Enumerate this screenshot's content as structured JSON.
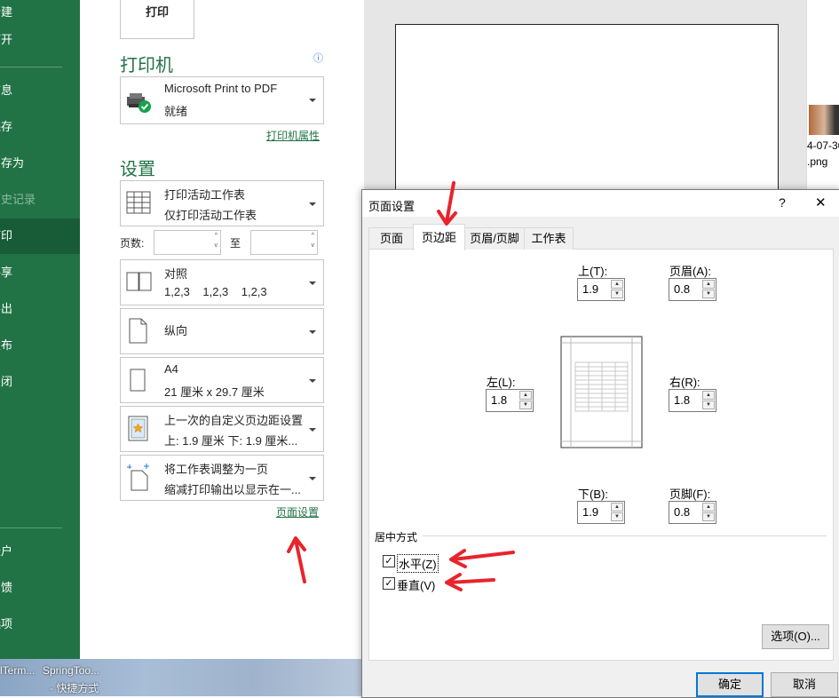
{
  "nav": {
    "items": [
      "新建",
      "打开",
      "信息",
      "保存",
      "另存为",
      "历史记录",
      "打印",
      "共享",
      "导出",
      "发布",
      "关闭",
      "帐户",
      "反馈",
      "选项"
    ],
    "active": "打印",
    "disabled": "历史记录"
  },
  "desktop": {
    "icon1_label": "lTerm...",
    "icon2_label": "SpringToo...",
    "icon2_sub": "- 快捷方式"
  },
  "print_button": "打印",
  "printer": {
    "section_title": "打印机",
    "name": "Microsoft Print to PDF",
    "status": "就绪",
    "properties_link": "打印机属性",
    "info_icon": "ⓘ"
  },
  "settings": {
    "section_title": "设置",
    "scope": {
      "title": "打印活动工作表",
      "desc": "仅打印活动工作表"
    },
    "pages_label": "页数:",
    "to_label": "至",
    "collate": {
      "title": "对照",
      "desc": "1,2,3    1,2,3    1,2,3"
    },
    "orientation": {
      "title": "纵向"
    },
    "paper": {
      "title": "A4",
      "desc": "21 厘米 x 29.7 厘米"
    },
    "margins": {
      "title": "上一次的自定义页边距设置",
      "desc": "上: 1.9 厘米 下: 1.9 厘米..."
    },
    "scaling": {
      "title": "将工作表调整为一页",
      "desc": "缩减打印输出以显示在一..."
    },
    "page_setup_link": "页面设置"
  },
  "thumb": {
    "label1": "4-07-30",
    "label2": ".png"
  },
  "dialog": {
    "title": "页面设置",
    "help": "?",
    "close": "✕",
    "tabs": [
      "页面",
      "页边距",
      "页眉/页脚",
      "工作表"
    ],
    "active_tab": "页边距",
    "top": {
      "label": "上(T):",
      "value": "1.9"
    },
    "header": {
      "label": "页眉(A):",
      "value": "0.8"
    },
    "left": {
      "label": "左(L):",
      "value": "1.8"
    },
    "right": {
      "label": "右(R):",
      "value": "1.8"
    },
    "bottom": {
      "label": "下(B):",
      "value": "1.9"
    },
    "footer": {
      "label": "页脚(F):",
      "value": "0.8"
    },
    "center_group": "居中方式",
    "horizontal": {
      "label": "水平(Z)",
      "checked": true
    },
    "vertical": {
      "label": "垂直(V)",
      "checked": true
    },
    "options_button": "选项(O)...",
    "ok_button": "确定",
    "cancel_button": "取消"
  },
  "colors": {
    "brand": "#217346",
    "annotation": "#e8242c",
    "focus": "#0078d7"
  }
}
